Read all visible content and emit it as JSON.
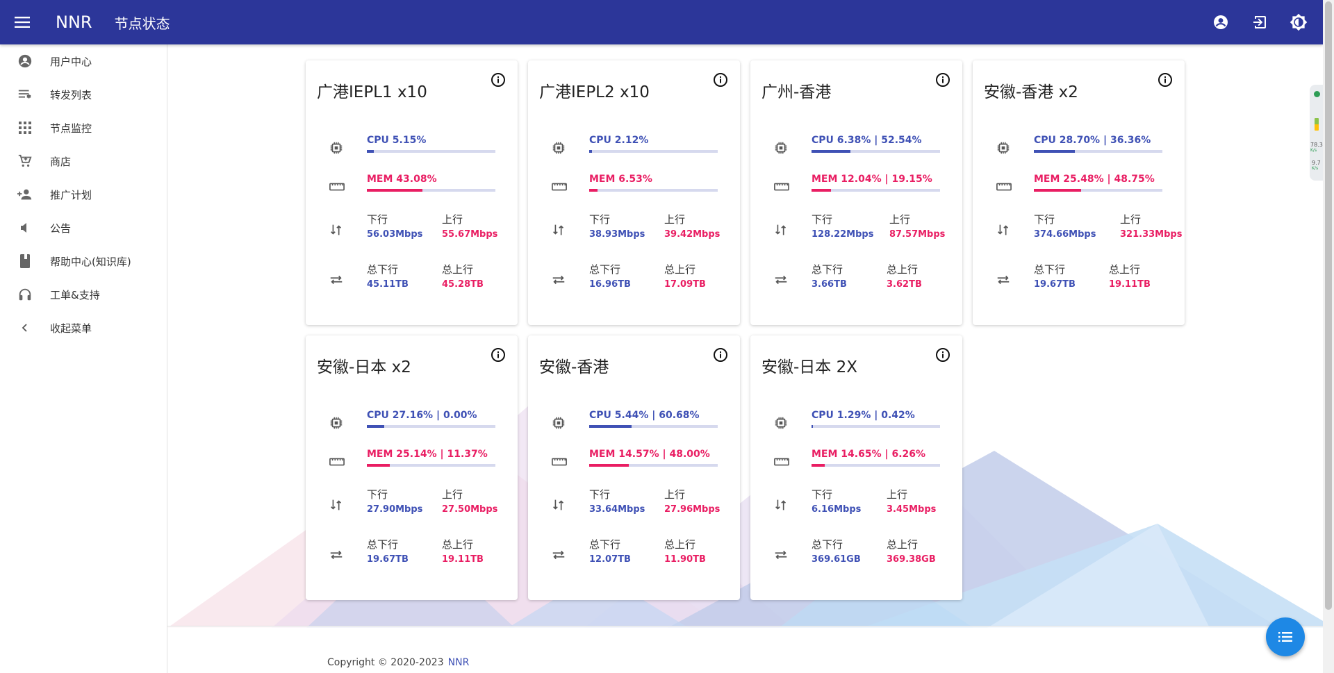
{
  "appbar": {
    "brand": "NNR",
    "page_title": "节点状态",
    "color": "#2c3699"
  },
  "sidebar": {
    "items": [
      {
        "label": "用户中心",
        "icon": "account-circle-icon"
      },
      {
        "label": "转发列表",
        "icon": "playlist-icon"
      },
      {
        "label": "节点监控",
        "icon": "apps-grid-icon"
      },
      {
        "label": "商店",
        "icon": "cart-icon"
      },
      {
        "label": "推广计划",
        "icon": "person-add-icon"
      },
      {
        "label": "公告",
        "icon": "speaker-icon"
      },
      {
        "label": "帮助中心(知识库)",
        "icon": "book-icon"
      },
      {
        "label": "工单&支持",
        "icon": "headset-icon"
      },
      {
        "label": "收起菜单",
        "icon": "chevron-left-icon"
      }
    ]
  },
  "labels": {
    "down": "下行",
    "up": "上行",
    "total_down": "总下行",
    "total_up": "总上行"
  },
  "nodes": [
    {
      "title": "广港IEPL1 x10",
      "cpu_text": "CPU 5.15%",
      "cpu": 5.15,
      "mem_text": "MEM 43.08%",
      "mem": 43.08,
      "down": "56.03Mbps",
      "up": "55.67Mbps",
      "total_down": "45.11TB",
      "total_up": "45.28TB"
    },
    {
      "title": "广港IEPL2 x10",
      "cpu_text": "CPU 2.12%",
      "cpu": 2.12,
      "mem_text": "MEM 6.53%",
      "mem": 6.53,
      "down": "38.93Mbps",
      "up": "39.42Mbps",
      "total_down": "16.96TB",
      "total_up": "17.09TB"
    },
    {
      "title": "广州-香港",
      "cpu_text": "CPU 6.38% | 52.54%",
      "cpu": 30,
      "mem_text": "MEM 12.04% | 19.15%",
      "mem": 15,
      "down": "128.22Mbps",
      "up": "87.57Mbps",
      "total_down": "3.66TB",
      "total_up": "3.62TB"
    },
    {
      "title": "安徽-香港 x2",
      "cpu_text": "CPU 28.70% | 36.36%",
      "cpu": 32,
      "mem_text": "MEM 25.48% | 48.75%",
      "mem": 37,
      "down": "374.66Mbps",
      "up": "321.33Mbps",
      "total_down": "19.67TB",
      "total_up": "19.11TB"
    },
    {
      "title": "安徽-日本 x2",
      "cpu_text": "CPU 27.16% | 0.00%",
      "cpu": 13.5,
      "mem_text": "MEM 25.14% | 11.37%",
      "mem": 18,
      "down": "27.90Mbps",
      "up": "27.50Mbps",
      "total_down": "19.67TB",
      "total_up": "19.11TB"
    },
    {
      "title": "安徽-香港",
      "cpu_text": "CPU 5.44% | 60.68%",
      "cpu": 33,
      "mem_text": "MEM 14.57% | 48.00%",
      "mem": 31,
      "down": "33.64Mbps",
      "up": "27.96Mbps",
      "total_down": "12.07TB",
      "total_up": "11.90TB"
    },
    {
      "title": "安徽-日本 2X",
      "cpu_text": "CPU 1.29% | 0.42%",
      "cpu": 1,
      "mem_text": "MEM 14.65% | 6.26%",
      "mem": 10,
      "down": "6.16Mbps",
      "up": "3.45Mbps",
      "total_down": "369.61GB",
      "total_up": "369.38GB"
    }
  ],
  "footer": {
    "copyright": "Copyright © 2020-2023",
    "brand": "NNR"
  },
  "net_widget": {
    "speed1": "78.3",
    "unit1": "K/s",
    "speed2": "9.7",
    "unit2": "K/s"
  },
  "colors": {
    "cpu": "#3f51b5",
    "mem": "#e91e63",
    "fab": "#1e88e5"
  }
}
